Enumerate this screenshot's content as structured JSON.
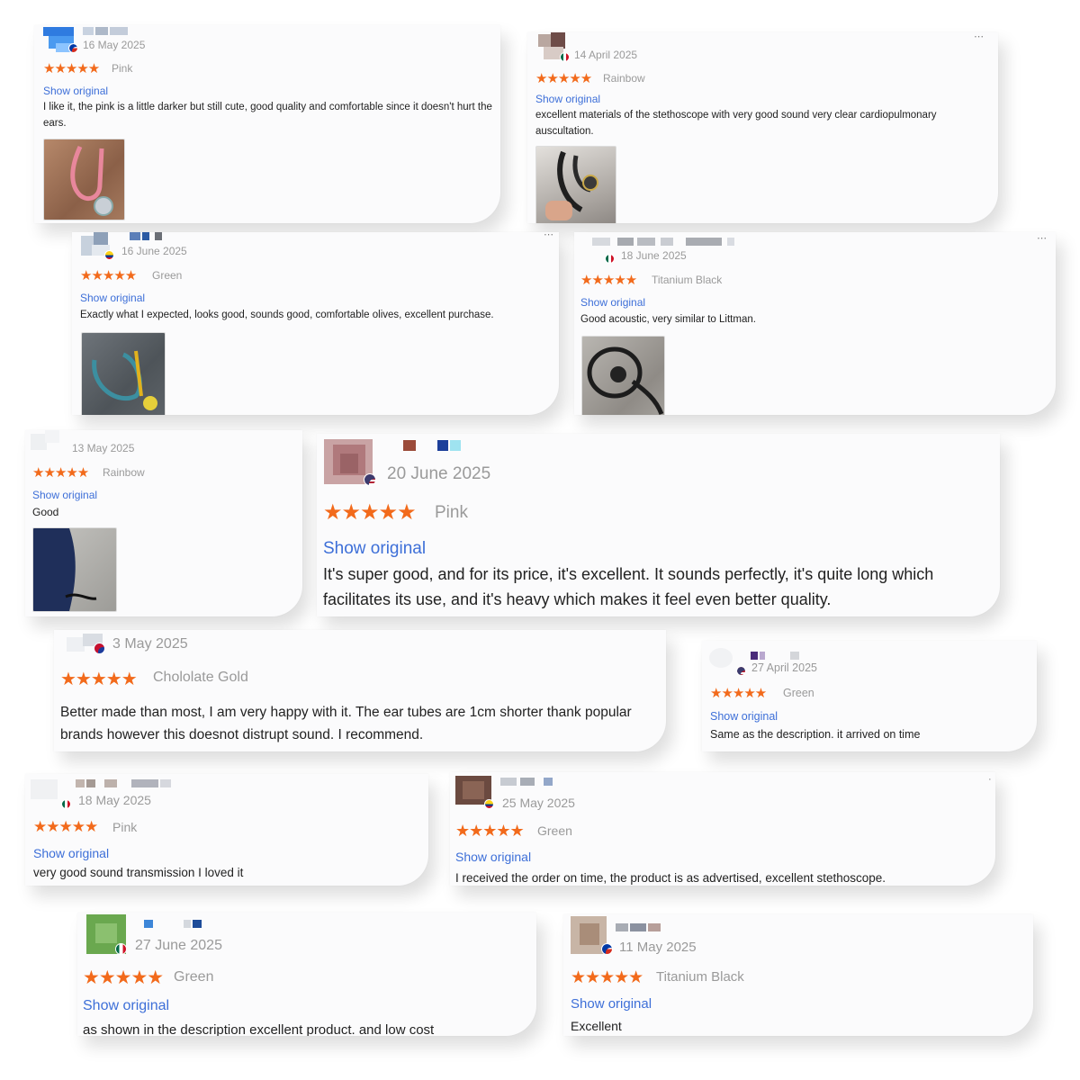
{
  "show_original_label": "Show original",
  "more_icon": "⋯",
  "star_color": "#f26a1b",
  "link_color": "#3d6fd8",
  "reviews": [
    {
      "date": "16 May 2025",
      "stars": "★★★★★",
      "rating": 5,
      "variant": "Pink",
      "text": "I like it, the pink is a little darker but still cute, good quality and comfortable since it doesn't hurt the ears.",
      "flag": "chile",
      "photo": "pink-stethoscope-photo"
    },
    {
      "date": "14 April 2025",
      "stars": "★★★★★",
      "rating": 5,
      "variant": "Rainbow",
      "text": "excellent materials of the stethoscope with very good sound very clear cardiopulmonary auscultation.",
      "flag": "mexico",
      "photo": "black-stethoscope-in-hand-photo"
    },
    {
      "date": "16 June 2025",
      "stars": "★★★★★",
      "rating": 5,
      "variant": "Green",
      "text": "Exactly what I expected, looks good, sounds good, comfortable olives, excellent purchase.",
      "flag": "colombia",
      "photo": "green-stethoscope-photo"
    },
    {
      "date": "18 June 2025",
      "stars": "★★★★★",
      "rating": 5,
      "variant": "Titanium Black",
      "text": "Good acoustic, very similar to Littman.",
      "flag": "mexico",
      "photo": "black-stethoscope-photo"
    },
    {
      "date": "13 May 2025",
      "stars": "★★★★★",
      "rating": 5,
      "variant": "Rainbow",
      "text": "Good",
      "flag": "none",
      "photo": "person-with-stethoscope-photo"
    },
    {
      "date": "20 June 2025",
      "stars": "★★★★★",
      "rating": 5,
      "variant": "Pink",
      "text": "It's super good, and for its price, it's excellent. It sounds perfectly, it's quite long which facilitates its use, and it's heavy which makes it feel even better quality.",
      "flag": "usa"
    },
    {
      "date": "3 May 2025",
      "stars": "★★★★★",
      "rating": 5,
      "variant": "Chololate Gold",
      "text": "Better made than most, I am very happy with it.   The ear tubes are 1cm shorter thank popular brands however this doesnot distrupt sound. I recommend.",
      "flag": "australia"
    },
    {
      "date": "27 April 2025",
      "stars": "★★★★★",
      "rating": 5,
      "variant": "Green",
      "text": "Same as the description. it arrived on time",
      "flag": "usa"
    },
    {
      "date": "18 May 2025",
      "stars": "★★★★★",
      "rating": 5,
      "variant": "Pink",
      "text": "very good sound transmission I loved it",
      "flag": "mexico"
    },
    {
      "date": "25 May 2025",
      "stars": "★★★★★",
      "rating": 5,
      "variant": "Green",
      "text": "I received the order on time, the product is as advertised, excellent stethoscope.",
      "flag": "colombia"
    },
    {
      "date": "27 June 2025",
      "stars": "★★★★★",
      "rating": 5,
      "variant": "Green",
      "text": "as shown in the description excellent product. and low cost",
      "flag": "mexico"
    },
    {
      "date": "11 May 2025",
      "stars": "★★★★★",
      "rating": 5,
      "variant": "Titanium Black",
      "text": "Excellent",
      "flag": "chile"
    }
  ]
}
